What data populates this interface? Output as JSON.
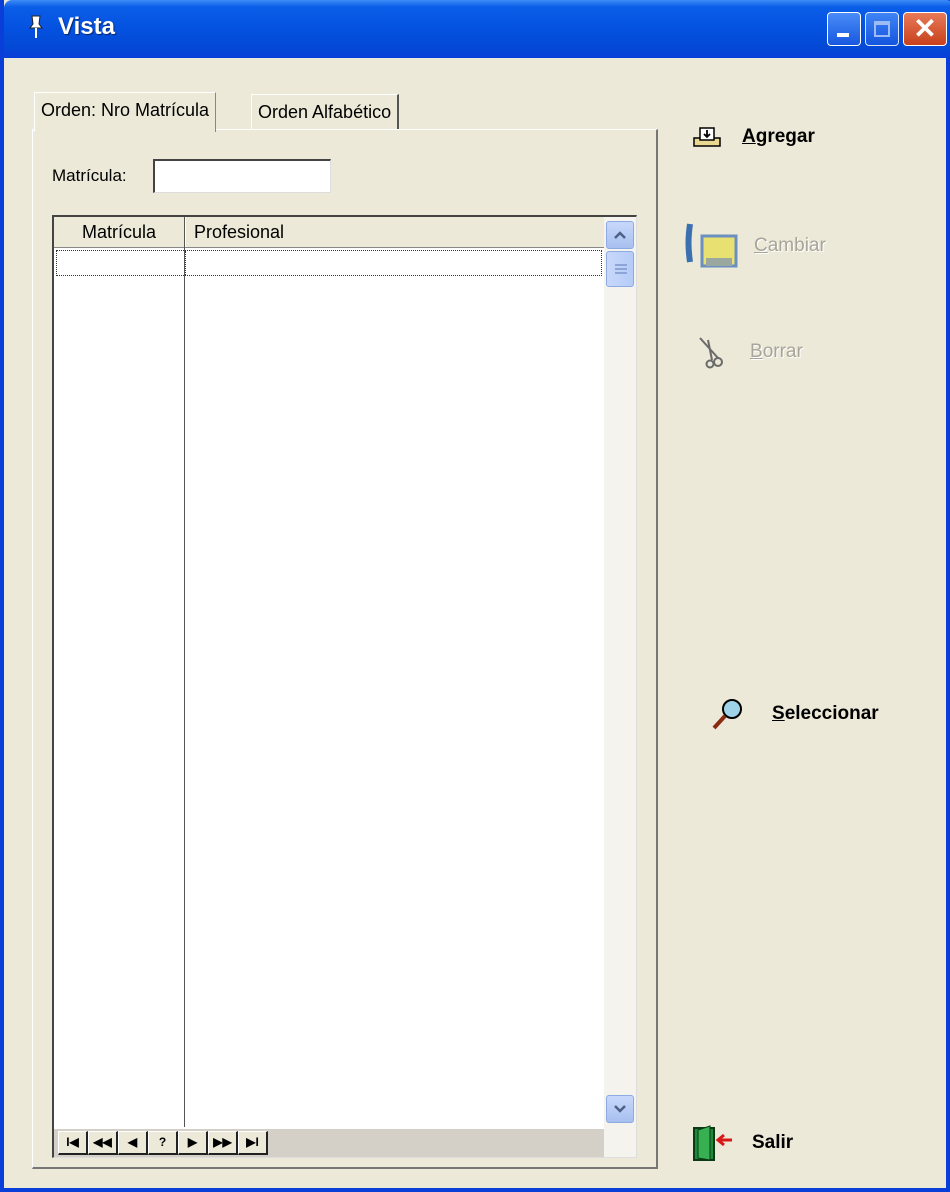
{
  "window": {
    "title": "Vista",
    "colors": {
      "titlebar": "#0553e1",
      "face": "#ece9d8",
      "close": "#c8401c"
    }
  },
  "tabs": [
    {
      "label": "Orden: Nro Matrícula",
      "active": true
    },
    {
      "label": "Orden Alfabético",
      "active": false
    }
  ],
  "search": {
    "label": "Matrícula:",
    "value": ""
  },
  "grid": {
    "columns": [
      "Matrícula",
      "Profesional"
    ],
    "rows": []
  },
  "navigator": {
    "buttons": [
      "I◀",
      "◀◀",
      "◀",
      "?",
      "▶",
      "▶▶",
      "▶I"
    ]
  },
  "actions": {
    "agregar": {
      "first": "A",
      "rest": "gregar",
      "icon": "add-record-icon",
      "enabled": true
    },
    "cambiar": {
      "first": "C",
      "rest": "ambiar",
      "icon": "edit-record-icon",
      "enabled": false
    },
    "borrar": {
      "first": "B",
      "rest": "orrar",
      "icon": "scissors-icon",
      "enabled": false
    },
    "seleccionar": {
      "first": "S",
      "rest": "eleccionar",
      "icon": "magnifier-icon",
      "enabled": true
    },
    "salir": {
      "label": "Salir",
      "icon": "exit-door-icon",
      "enabled": true
    }
  }
}
